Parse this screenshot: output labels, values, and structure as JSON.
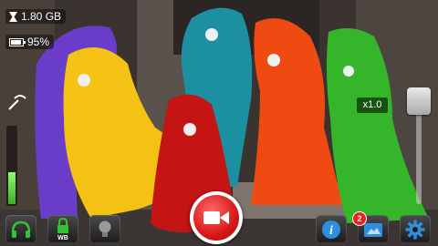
{
  "status": {
    "storage_text": "1.80 GB",
    "battery_text": "95%",
    "battery_level": 0.95
  },
  "zoom": {
    "label": "x1.0",
    "level": 0.0
  },
  "volume": {
    "level": 0.42
  },
  "toolbar": {
    "lock_label": "WB",
    "notification_count": "2"
  },
  "colors": {
    "record_red": "#d81818",
    "icon_green": "#35c235",
    "icon_blue": "#2e8fe0"
  },
  "icons": [
    "hourglass-icon",
    "battery-icon",
    "headset-icon",
    "lock-icon",
    "bulb-icon",
    "camera-icon",
    "info-icon",
    "gallery-icon",
    "gear-icon"
  ]
}
